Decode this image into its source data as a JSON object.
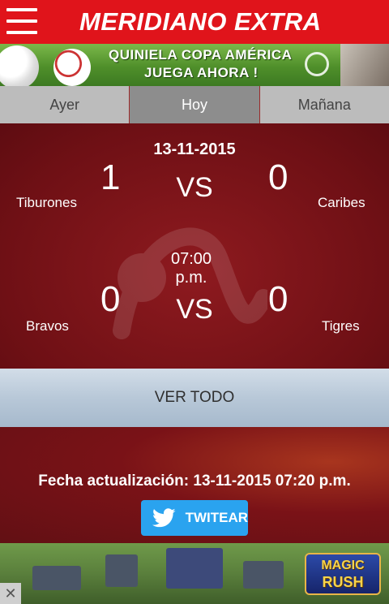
{
  "app": {
    "title": "MERIDIANO EXTRA"
  },
  "banner_top": {
    "line1": "QUINIELA COPA AMÉRICA",
    "line2": "JUEGA AHORA !"
  },
  "tabs": [
    {
      "label": "Ayer",
      "active": false
    },
    {
      "label": "Hoy",
      "active": true
    },
    {
      "label": "Mañana",
      "active": false
    }
  ],
  "scores": {
    "date": "13-11-2015",
    "matches": [
      {
        "home_team": "Tiburones",
        "home_score": "1",
        "vs": "VS",
        "away_score": "0",
        "away_team": "Caribes",
        "time": ""
      },
      {
        "home_team": "Bravos",
        "home_score": "0",
        "vs": "VS",
        "away_score": "0",
        "away_team": "Tigres",
        "time": "07:00 p.m."
      }
    ]
  },
  "ver_todo": {
    "label": "VER TODO"
  },
  "footer": {
    "updated": "Fecha actualización: 13-11-2015 07:20 p.m.",
    "tweet_label": "TWITEAR"
  },
  "banner_bottom": {
    "logo_line1": "MAGIC",
    "logo_line2": "RUSH",
    "close_glyph": "✕"
  },
  "colors": {
    "brand_red": "#e0141b",
    "panel_red": "#6f1015",
    "twitter_blue": "#2aa3ef"
  }
}
